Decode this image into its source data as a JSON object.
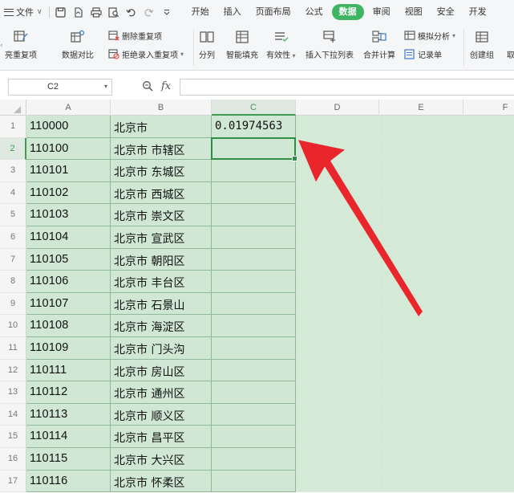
{
  "menubar": {
    "file_label": "文件",
    "tabs": [
      "开始",
      "插入",
      "页面布局",
      "公式",
      "数据",
      "审阅",
      "视图",
      "安全",
      "开发"
    ],
    "active_tab": "数据"
  },
  "ribbon": {
    "highlight_dup": "亮重复项",
    "compare": "数据对比",
    "delete_dup": "删除重复项",
    "reject_dup": "拒绝录入重复项",
    "split": "分列",
    "smart_fill": "智能填充",
    "validity": "有效性",
    "dropdown_list": "插入下拉列表",
    "consolidate": "合并计算",
    "simulation": "模拟分析",
    "record_sheet": "记录单",
    "create_group": "创建组",
    "ungroup": "取"
  },
  "formula_bar": {
    "cell_ref": "C2",
    "fx_label": "fx",
    "formula_value": ""
  },
  "sheet": {
    "columns": [
      "A",
      "B",
      "C",
      "D",
      "E",
      "F"
    ],
    "selected_column": "C",
    "selected_row": 2,
    "rows": [
      {
        "n": "1",
        "a": "110000",
        "b": "北京市",
        "c": "0.01974563"
      },
      {
        "n": "2",
        "a": "110100",
        "b": "北京市  市辖区",
        "c": ""
      },
      {
        "n": "3",
        "a": "110101",
        "b": "北京市  东城区",
        "c": ""
      },
      {
        "n": "4",
        "a": "110102",
        "b": "北京市  西城区",
        "c": ""
      },
      {
        "n": "5",
        "a": "110103",
        "b": "北京市  崇文区",
        "c": ""
      },
      {
        "n": "6",
        "a": "110104",
        "b": "北京市  宣武区",
        "c": ""
      },
      {
        "n": "7",
        "a": "110105",
        "b": "北京市  朝阳区",
        "c": ""
      },
      {
        "n": "8",
        "a": "110106",
        "b": "北京市  丰台区",
        "c": ""
      },
      {
        "n": "9",
        "a": "110107",
        "b": "北京市  石景山",
        "c": ""
      },
      {
        "n": "10",
        "a": "110108",
        "b": "北京市  海淀区",
        "c": ""
      },
      {
        "n": "11",
        "a": "110109",
        "b": "北京市  门头沟",
        "c": ""
      },
      {
        "n": "12",
        "a": "110111",
        "b": "北京市  房山区",
        "c": ""
      },
      {
        "n": "13",
        "a": "110112",
        "b": "北京市  通州区",
        "c": ""
      },
      {
        "n": "14",
        "a": "110113",
        "b": "北京市  顺义区",
        "c": ""
      },
      {
        "n": "15",
        "a": "110114",
        "b": "北京市  昌平区",
        "c": ""
      },
      {
        "n": "16",
        "a": "110115",
        "b": "北京市  大兴区",
        "c": ""
      },
      {
        "n": "17",
        "a": "110116",
        "b": "北京市  怀柔区",
        "c": ""
      }
    ]
  },
  "colors": {
    "accent_green": "#3fb563",
    "cell_fill": "#cfe7d3",
    "arrow_red": "#e8262b"
  }
}
